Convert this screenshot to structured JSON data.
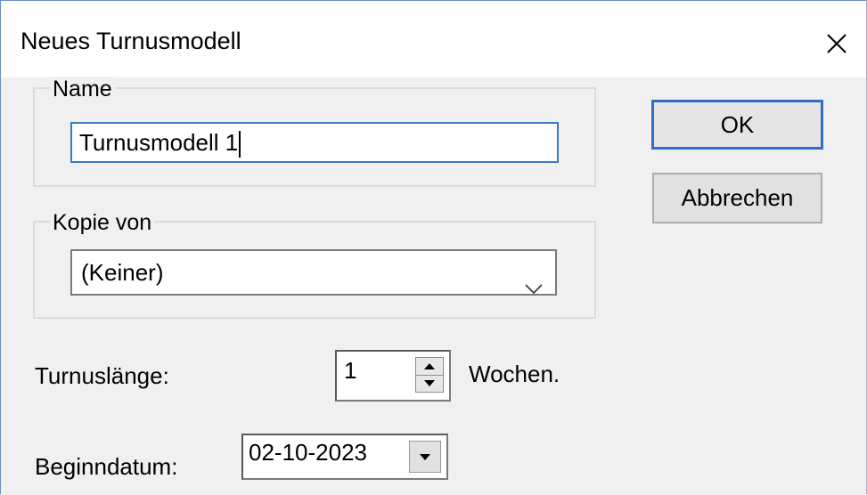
{
  "dialog": {
    "title": "Neues Turnusmodell",
    "close_icon": "close-icon"
  },
  "name_group": {
    "label": "Name",
    "value": "Turnusmodell 1"
  },
  "copy_group": {
    "label": "Kopie von",
    "selected": "(Keiner)",
    "icon": "chevron-down-icon"
  },
  "buttons": {
    "ok": "OK",
    "cancel": "Abbrechen"
  },
  "length": {
    "label": "Turnuslänge:",
    "value": "1",
    "unit": "Wochen.",
    "icons": [
      "spin-up-icon",
      "spin-down-icon"
    ]
  },
  "start": {
    "label": "Beginndatum:",
    "value": "02-10-2023",
    "icon": "dropdown-arrow-icon"
  },
  "colors": {
    "focus_border": "#3b79c2",
    "default_button_border": "#2f6fc4",
    "dialog_bg": "#f0f0f0"
  }
}
